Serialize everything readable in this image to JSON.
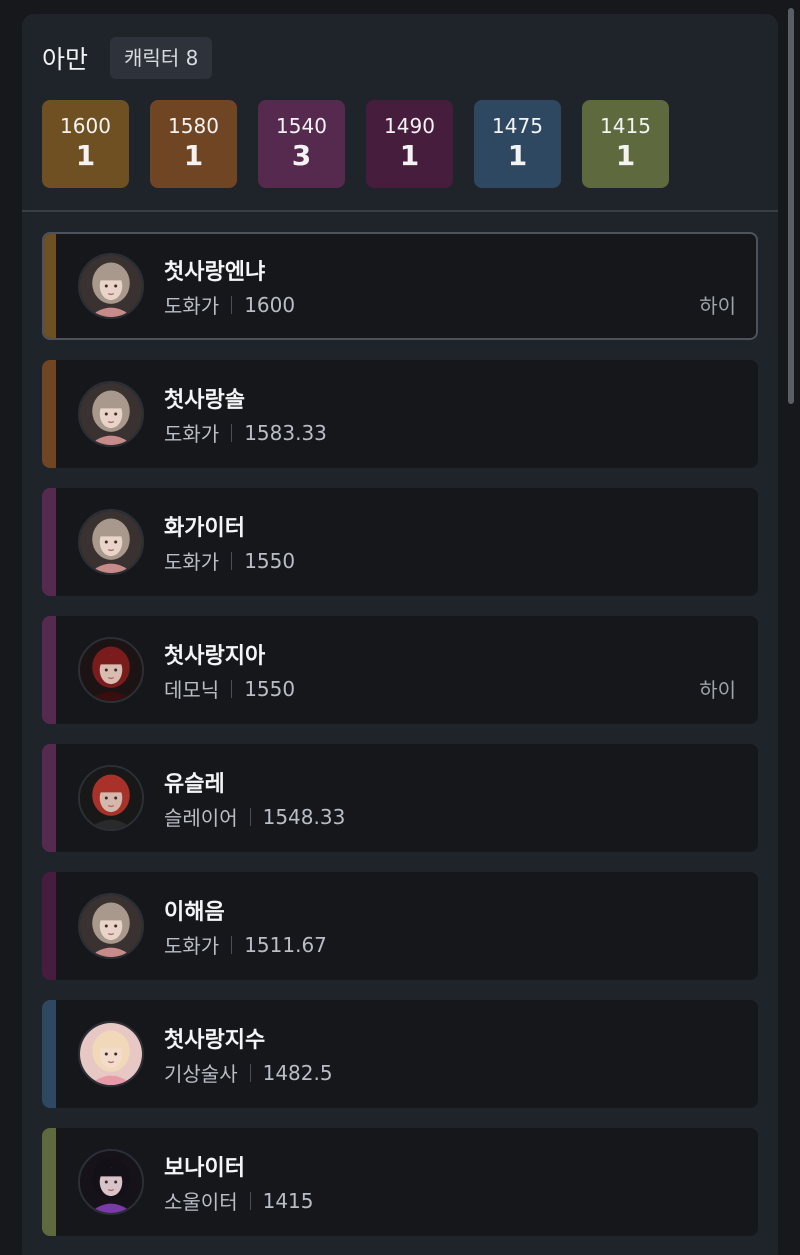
{
  "header": {
    "server_name": "아만",
    "character_count": "캐릭터 8"
  },
  "tiers": [
    {
      "level": "1600",
      "count": "1",
      "color": "#6e5022"
    },
    {
      "level": "1580",
      "count": "1",
      "color": "#6f4523"
    },
    {
      "level": "1540",
      "count": "3",
      "color": "#552a4e"
    },
    {
      "level": "1490",
      "count": "1",
      "color": "#471d3d"
    },
    {
      "level": "1475",
      "count": "1",
      "color": "#2d4860"
    },
    {
      "level": "1415",
      "count": "1",
      "color": "#5e6a3d"
    }
  ],
  "characters": [
    {
      "name": "첫사랑엔냐",
      "class": "도화가",
      "level": "1600",
      "memo": "하이",
      "bar_color": "#6e5022",
      "avatar": "artist-portrait",
      "selected": true
    },
    {
      "name": "첫사랑솔",
      "class": "도화가",
      "level": "1583.33",
      "memo": "",
      "bar_color": "#6f4523",
      "avatar": "artist-portrait"
    },
    {
      "name": "화가이터",
      "class": "도화가",
      "level": "1550",
      "memo": "",
      "bar_color": "#552a4e",
      "avatar": "artist-portrait"
    },
    {
      "name": "첫사랑지아",
      "class": "데모닉",
      "level": "1550",
      "memo": "하이",
      "bar_color": "#552a4e",
      "avatar": "demonic-portrait"
    },
    {
      "name": "유슬레",
      "class": "슬레이어",
      "level": "1548.33",
      "memo": "",
      "bar_color": "#552a4e",
      "avatar": "slayer-portrait"
    },
    {
      "name": "이해음",
      "class": "도화가",
      "level": "1511.67",
      "memo": "",
      "bar_color": "#471d3d",
      "avatar": "artist-portrait"
    },
    {
      "name": "첫사랑지수",
      "class": "기상술사",
      "level": "1482.5",
      "memo": "",
      "bar_color": "#2d4860",
      "avatar": "aeromancer-portrait"
    },
    {
      "name": "보나이터",
      "class": "소울이터",
      "level": "1415",
      "memo": "",
      "bar_color": "#5e6a3d",
      "avatar": "souleater-portrait"
    }
  ]
}
